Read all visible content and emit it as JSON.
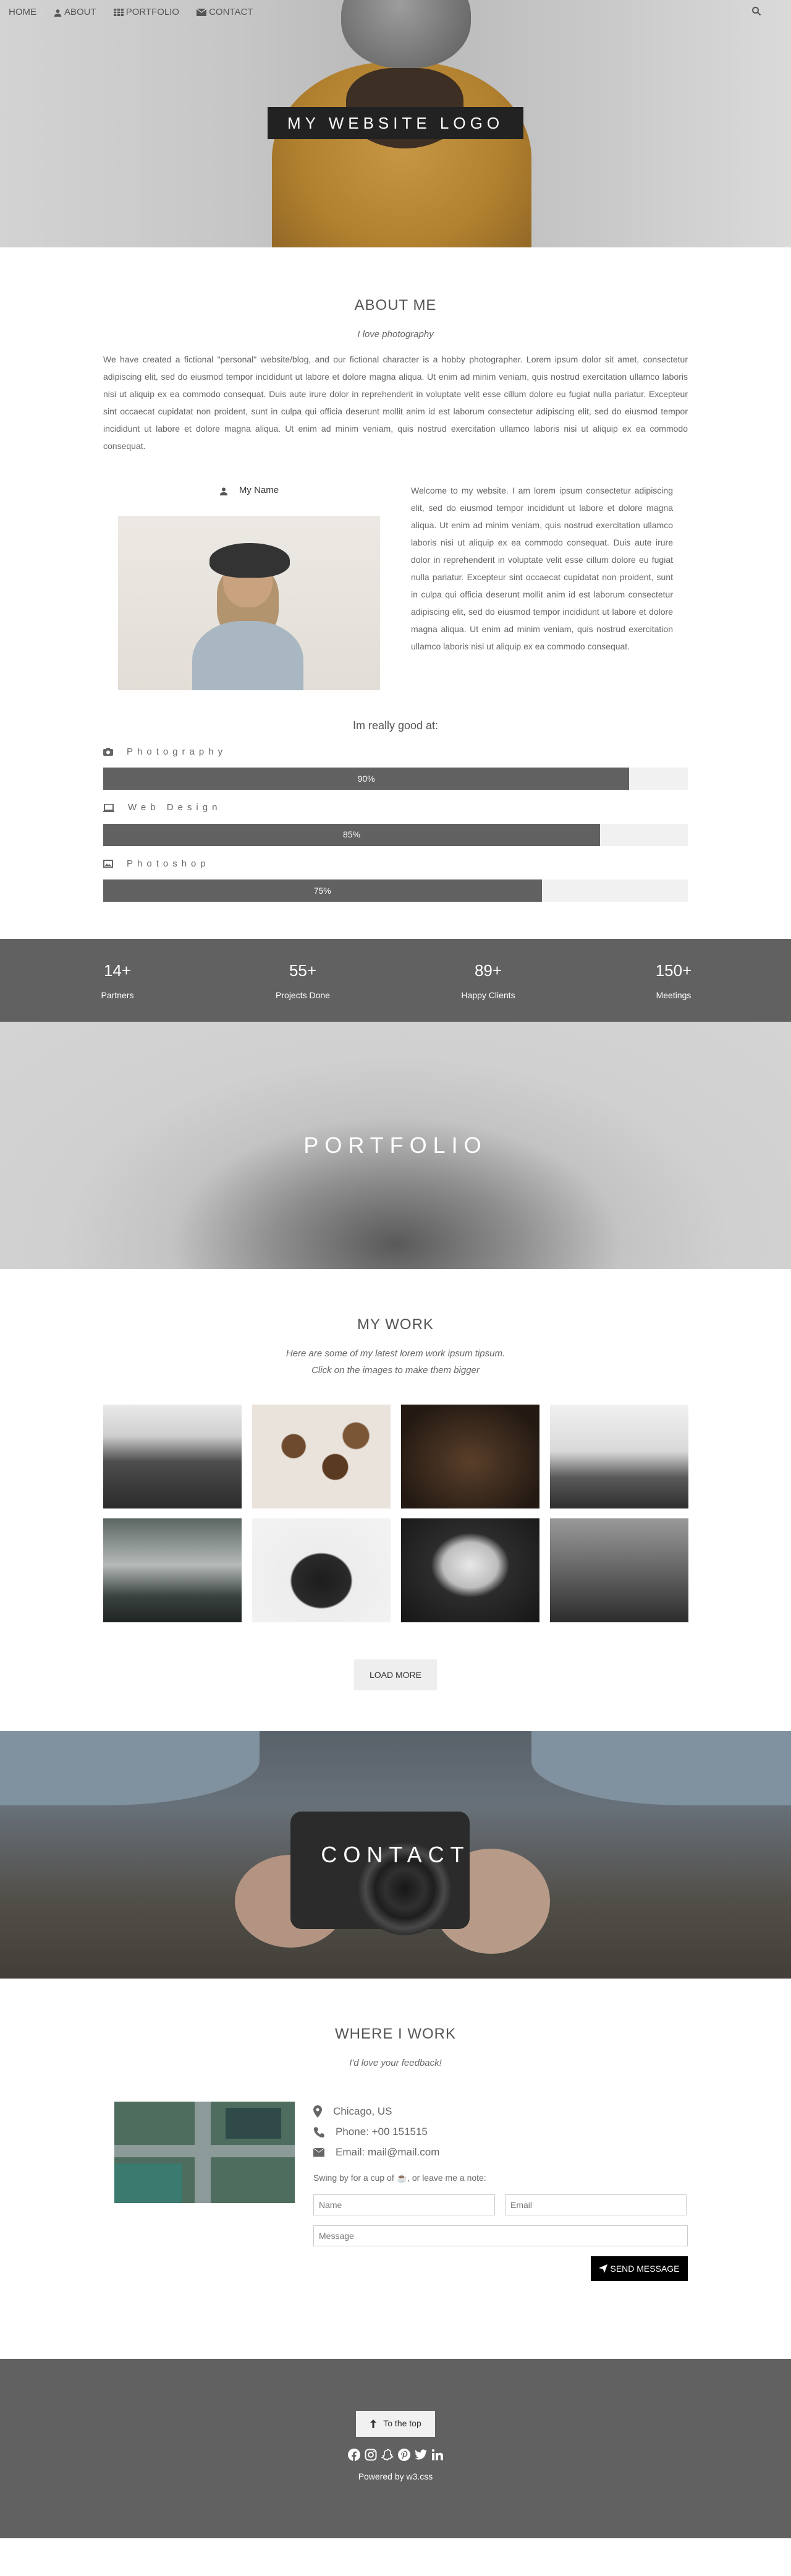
{
  "nav": {
    "items": [
      {
        "label": "HOME"
      },
      {
        "label": "ABOUT"
      },
      {
        "label": "PORTFOLIO"
      },
      {
        "label": "CONTACT"
      }
    ]
  },
  "hero": {
    "logo": "MY WEBSITE LOGO"
  },
  "about": {
    "title": "ABOUT ME",
    "subtitle": "I love photography",
    "text": "We have created a fictional \"personal\" website/blog, and our fictional character is a hobby photographer. Lorem ipsum dolor sit amet, consectetur adipiscing elit, sed do eiusmod tempor incididunt ut labore et dolore magna aliqua. Ut enim ad minim veniam, quis nostrud exercitation ullamco laboris nisi ut aliquip ex ea commodo consequat. Duis aute irure dolor in reprehenderit in voluptate velit esse cillum dolore eu fugiat nulla pariatur. Excepteur sint occaecat cupidatat non proident, sunt in culpa qui officia deserunt mollit anim id est laborum consectetur adipiscing elit, sed do eiusmod tempor incididunt ut labore et dolore magna aliqua. Ut enim ad minim veniam, quis nostrud exercitation ullamco laboris nisi ut aliquip ex ea commodo consequat.",
    "name": "My Name",
    "welcome": "Welcome to my website. I am lorem ipsum consectetur adipiscing elit, sed do eiusmod tempor incididunt ut labore et dolore magna aliqua. Ut enim ad minim veniam, quis nostrud exercitation ullamco laboris nisi ut aliquip ex ea commodo consequat. Duis aute irure dolor in reprehenderit in voluptate velit esse cillum dolore eu fugiat nulla pariatur. Excepteur sint occaecat cupidatat non proident, sunt in culpa qui officia deserunt mollit anim id est laborum consectetur adipiscing elit, sed do eiusmod tempor incididunt ut labore et dolore magna aliqua. Ut enim ad minim veniam, quis nostrud exercitation ullamco laboris nisi ut aliquip ex ea commodo consequat.",
    "good_at": "Im really good at:",
    "skills": [
      {
        "label": "Photography",
        "value": 90,
        "display": "90%",
        "icon": "camera-icon"
      },
      {
        "label": "Web Design",
        "value": 85,
        "display": "85%",
        "icon": "laptop-icon"
      },
      {
        "label": "Photoshop",
        "value": 75,
        "display": "75%",
        "icon": "image-icon"
      }
    ]
  },
  "stats": [
    {
      "number": "14+",
      "label": "Partners"
    },
    {
      "number": "55+",
      "label": "Projects Done"
    },
    {
      "number": "89+",
      "label": "Happy Clients"
    },
    {
      "number": "150+",
      "label": "Meetings"
    }
  ],
  "portfolio": {
    "title": "PORTFOLIO"
  },
  "work": {
    "title": "MY WORK",
    "line1": "Here are some of my latest lorem work ipsum tipsum.",
    "line2": "Click on the images to make them bigger",
    "photos": [
      "mountains",
      "coffee beans",
      "bear",
      "ocean fog",
      "foggy forest",
      "typewriter",
      "train window",
      "lonely sea"
    ],
    "load_more": "LOAD MORE"
  },
  "contact": {
    "title": "CONTACT"
  },
  "where": {
    "title": "WHERE I WORK",
    "subtitle": "I'd love your feedback!",
    "location": "Chicago, US",
    "phone": "Phone: +00 151515",
    "email": "Email: mail@mail.com",
    "note_before": "Swing by for a cup of ",
    "note_after": ", or leave me a note:",
    "placeholders": {
      "name": "Name",
      "email": "Email",
      "message": "Message"
    },
    "send": "SEND MESSAGE"
  },
  "footer": {
    "totop": "To the top",
    "powered_prefix": "Powered by ",
    "powered_link": "w3.css"
  },
  "colors": {
    "dark_gray": "#616161",
    "black": "#000000",
    "bar_bg": "#f1f1f1"
  }
}
